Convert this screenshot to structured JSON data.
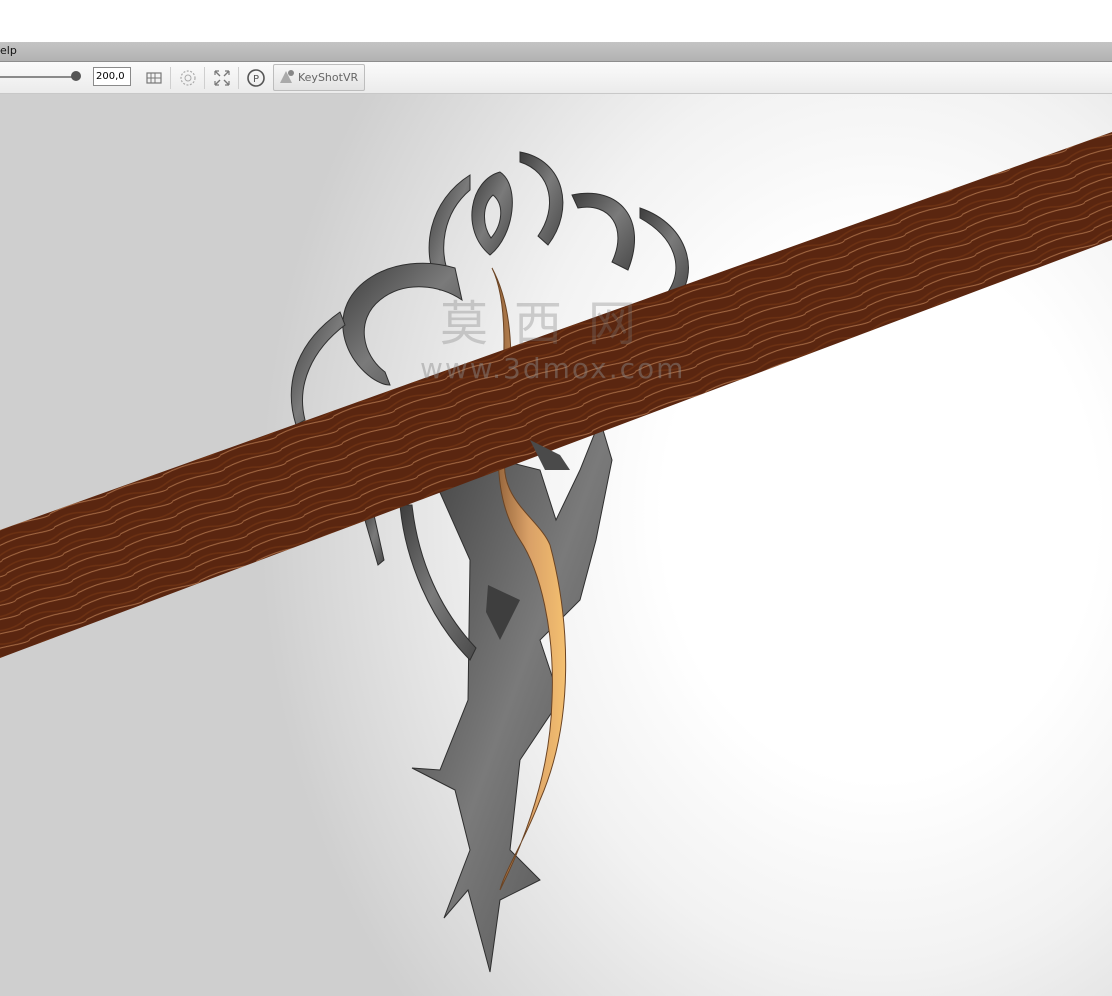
{
  "menu": {
    "help_fragment": "elp"
  },
  "toolbar": {
    "value": "200,0",
    "vr_label": "KeyShotVR",
    "icons": [
      "grid-icon",
      "render-region-icon",
      "fit-view-icon",
      "network-icon",
      "keyshot-vr-icon"
    ]
  },
  "viewport": {
    "watermark_cn": "莫西网",
    "watermark_url": "www.3dmox.com",
    "colors": {
      "wood": "#c26a2c",
      "metal": "#6d6d6d",
      "gold": "#e0a552"
    }
  }
}
